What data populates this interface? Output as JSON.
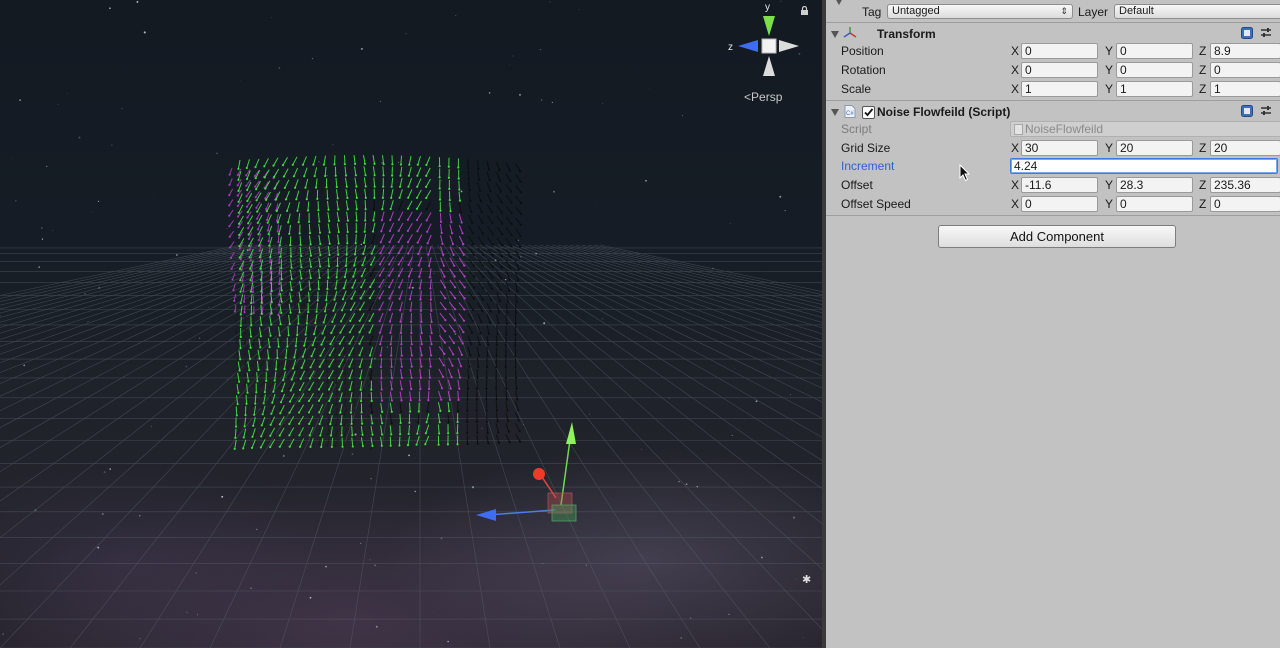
{
  "scene": {
    "view_mode": "Persp",
    "gizmo_axes": {
      "y": "y",
      "z": "z"
    }
  },
  "inspector": {
    "tag_label": "Tag",
    "tag_value": "Untagged",
    "layer_label": "Layer",
    "layer_value": "Default",
    "transform": {
      "title": "Transform",
      "rows": [
        {
          "label": "Position",
          "x": "0",
          "y": "0",
          "z": "8.9"
        },
        {
          "label": "Rotation",
          "x": "0",
          "y": "0",
          "z": "0"
        },
        {
          "label": "Scale",
          "x": "1",
          "y": "1",
          "z": "1"
        }
      ]
    },
    "script_component": {
      "title": "Noise Flowfeild (Script)",
      "enabled": true,
      "script_label": "Script",
      "script_value": "NoiseFlowfeild",
      "grid_size": {
        "label": "Grid Size",
        "x": "30",
        "y": "20",
        "z": "20"
      },
      "increment": {
        "label": "Increment",
        "value": "4.24"
      },
      "offset": {
        "label": "Offset",
        "x": "-11.6",
        "y": "28.3",
        "z": "235.36"
      },
      "offset_speed": {
        "label": "Offset Speed",
        "x": "0",
        "y": "0",
        "z": "0"
      }
    },
    "add_component_label": "Add Component",
    "axis_labels": {
      "x": "X",
      "y": "Y",
      "z": "Z"
    }
  },
  "colors": {
    "inspector_bg": "#c2c2c2",
    "active_label": "#2f5fd0",
    "field_green": "#3cdc3c",
    "field_purple": "#b43cc8"
  }
}
